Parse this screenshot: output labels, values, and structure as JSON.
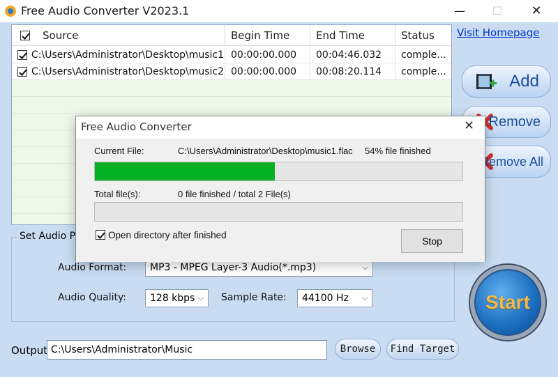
{
  "window": {
    "title": "Free Audio Converter V2023.1",
    "minimize": "—",
    "maximize": "☐",
    "close": "✕"
  },
  "file_list": {
    "columns": [
      "Source",
      "Begin Time",
      "End Time",
      "Status"
    ],
    "rows": [
      {
        "checked": true,
        "source": "C:\\Users\\Administrator\\Desktop\\music1...",
        "begin": "00:00:00.000",
        "end": "00:04:46.032",
        "status": "comple..."
      },
      {
        "checked": true,
        "source": "C:\\Users\\Administrator\\Desktop\\music2...",
        "begin": "00:00:00.000",
        "end": "00:08:20.114",
        "status": "comple..."
      }
    ]
  },
  "sidebar": {
    "visit_homepage": "Visit Homepage",
    "add": "Add",
    "remove": "Remove",
    "remove_all": "Remove All"
  },
  "params": {
    "group_title": "Set Audio Pa",
    "format_label": "Audio Format:",
    "format_value": "MP3 - MPEG Layer-3 Audio(*.mp3)",
    "quality_label": "Audio Quality:",
    "quality_value": "128 kbps",
    "rate_label": "Sample Rate:",
    "rate_value": "44100 Hz"
  },
  "start_label": "Start",
  "output": {
    "label": "Output",
    "path": "C:\\Users\\Administrator\\Music",
    "browse": "Browse",
    "find_target": "Find Target"
  },
  "dialog": {
    "title": "Free Audio Converter",
    "close": "✕",
    "current_file_label": "Current File:",
    "current_file_value": "C:\\Users\\Administrator\\Desktop\\music1.flac",
    "current_percent_text": "54% file finished",
    "current_progress": 0.49,
    "total_label": "Total file(s):",
    "total_value": "0 file finished / total 2 File(s)",
    "total_progress": 0,
    "open_dir_checked": true,
    "open_dir_label": "Open directory after finished",
    "stop": "Stop"
  },
  "colors": {
    "progress_fill": "#06b025",
    "link": "#0033cc",
    "start_text": "#f2b84b"
  }
}
